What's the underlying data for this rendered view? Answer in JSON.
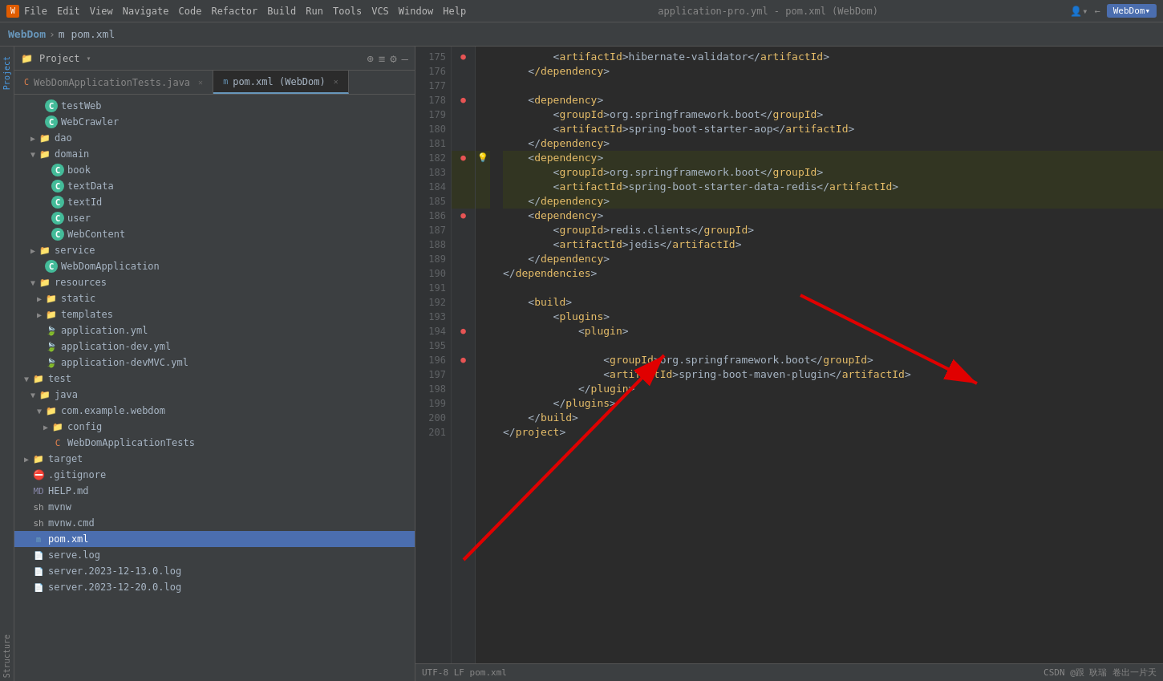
{
  "titlebar": {
    "app_icon": "W",
    "menu_items": [
      "File",
      "Edit",
      "View",
      "Navigate",
      "Code",
      "Refactor",
      "Build",
      "Run",
      "Tools",
      "VCS",
      "Window",
      "Help"
    ],
    "title": "application-pro.yml - pom.xml (WebDom)",
    "webdom_button": "WebDom▾"
  },
  "breadcrumb": {
    "project": "WebDom",
    "separator": "›",
    "file": "m pom.xml"
  },
  "tabs": [
    {
      "id": "java-tab",
      "label": "WebDomApplicationTests.java",
      "type": "java",
      "active": false
    },
    {
      "id": "xml-tab",
      "label": "pom.xml (WebDom)",
      "type": "xml",
      "active": true
    }
  ],
  "project_panel": {
    "title": "Project",
    "tree_items": [
      {
        "indent": 24,
        "arrow": "",
        "icon_type": "c",
        "label": "testWeb",
        "selected": false
      },
      {
        "indent": 24,
        "arrow": "",
        "icon_type": "c",
        "label": "WebCrawler",
        "selected": false
      },
      {
        "indent": 16,
        "arrow": "▶",
        "icon_type": "folder",
        "label": "dao",
        "selected": false
      },
      {
        "indent": 16,
        "arrow": "▼",
        "icon_type": "folder",
        "label": "domain",
        "selected": false
      },
      {
        "indent": 32,
        "arrow": "",
        "icon_type": "c",
        "label": "book",
        "selected": false
      },
      {
        "indent": 32,
        "arrow": "",
        "icon_type": "c",
        "label": "textData",
        "selected": false
      },
      {
        "indent": 32,
        "arrow": "",
        "icon_type": "c",
        "label": "textId",
        "selected": false
      },
      {
        "indent": 32,
        "arrow": "",
        "icon_type": "c",
        "label": "user",
        "selected": false
      },
      {
        "indent": 32,
        "arrow": "",
        "icon_type": "c",
        "label": "WebContent",
        "selected": false
      },
      {
        "indent": 16,
        "arrow": "▶",
        "icon_type": "folder",
        "label": "service",
        "selected": false
      },
      {
        "indent": 24,
        "arrow": "",
        "icon_type": "c",
        "label": "WebDomApplication",
        "selected": false
      },
      {
        "indent": 16,
        "arrow": "▼",
        "icon_type": "folder-res",
        "label": "resources",
        "selected": false
      },
      {
        "indent": 24,
        "arrow": "▶",
        "icon_type": "folder",
        "label": "static",
        "selected": false
      },
      {
        "indent": 24,
        "arrow": "▶",
        "icon_type": "folder",
        "label": "templates",
        "selected": false
      },
      {
        "indent": 24,
        "arrow": "",
        "icon_type": "yml",
        "label": "application.yml",
        "selected": false
      },
      {
        "indent": 24,
        "arrow": "",
        "icon_type": "yml",
        "label": "application-dev.yml",
        "selected": false
      },
      {
        "indent": 24,
        "arrow": "",
        "icon_type": "yml",
        "label": "application-devMVC.yml",
        "selected": false
      },
      {
        "indent": 8,
        "arrow": "▼",
        "icon_type": "folder",
        "label": "test",
        "selected": false
      },
      {
        "indent": 16,
        "arrow": "▼",
        "icon_type": "folder",
        "label": "java",
        "selected": false
      },
      {
        "indent": 24,
        "arrow": "▼",
        "icon_type": "folder",
        "label": "com.example.webdom",
        "selected": false
      },
      {
        "indent": 32,
        "arrow": "▶",
        "icon_type": "folder",
        "label": "config",
        "selected": false
      },
      {
        "indent": 32,
        "arrow": "",
        "icon_type": "java",
        "label": "WebDomApplicationTests",
        "selected": false
      },
      {
        "indent": 8,
        "arrow": "▶",
        "icon_type": "folder-target",
        "label": "target",
        "selected": false
      },
      {
        "indent": 8,
        "arrow": "",
        "icon_type": "git",
        "label": ".gitignore",
        "selected": false
      },
      {
        "indent": 8,
        "arrow": "",
        "icon_type": "md",
        "label": "HELP.md",
        "selected": false
      },
      {
        "indent": 8,
        "arrow": "",
        "icon_type": "sh",
        "label": "mvnw",
        "selected": false
      },
      {
        "indent": 8,
        "arrow": "",
        "icon_type": "sh",
        "label": "mvnw.cmd",
        "selected": false
      },
      {
        "indent": 8,
        "arrow": "",
        "icon_type": "xml",
        "label": "pom.xml",
        "selected": true
      },
      {
        "indent": 8,
        "arrow": "",
        "icon_type": "log",
        "label": "serve.log",
        "selected": false
      },
      {
        "indent": 8,
        "arrow": "",
        "icon_type": "log",
        "label": "server.2023-12-13.0.log",
        "selected": false
      },
      {
        "indent": 8,
        "arrow": "",
        "icon_type": "log",
        "label": "server.2023-12-20.0.log",
        "selected": false
      }
    ]
  },
  "code": {
    "lines": [
      {
        "num": 175,
        "indent": 8,
        "content": "<artifactId>hibernate-validator</artifactId>",
        "marker": "",
        "highlighted": false
      },
      {
        "num": 176,
        "indent": 4,
        "content": "</dependency>",
        "marker": "",
        "highlighted": false
      },
      {
        "num": 177,
        "indent": 0,
        "content": "",
        "marker": "",
        "highlighted": false
      },
      {
        "num": 178,
        "indent": 4,
        "content": "<dependency>",
        "marker": "●",
        "highlighted": false
      },
      {
        "num": 179,
        "indent": 8,
        "content": "<groupId>org.springframework.boot</groupId>",
        "marker": "",
        "highlighted": false
      },
      {
        "num": 180,
        "indent": 8,
        "content": "<artifactId>spring-boot-starter-aop</artifactId>",
        "marker": "",
        "highlighted": false
      },
      {
        "num": 181,
        "indent": 4,
        "content": "</dependency>",
        "marker": "",
        "highlighted": false
      },
      {
        "num": 182,
        "indent": 4,
        "content": "<dependency>",
        "marker": "●",
        "highlighted": true,
        "bulb": true
      },
      {
        "num": 183,
        "indent": 8,
        "content": "<groupId>org.springframework.boot</groupId>",
        "marker": "",
        "highlighted": true
      },
      {
        "num": 184,
        "indent": 8,
        "content": "<artifactId>spring-boot-starter-data-redis</artifactId>",
        "marker": "",
        "highlighted": true
      },
      {
        "num": 185,
        "indent": 4,
        "content": "</dependency>",
        "marker": "",
        "highlighted": true
      },
      {
        "num": 186,
        "indent": 4,
        "content": "<dependency>",
        "marker": "●",
        "highlighted": false
      },
      {
        "num": 187,
        "indent": 8,
        "content": "<groupId>redis.clients</groupId>",
        "marker": "",
        "highlighted": false
      },
      {
        "num": 188,
        "indent": 8,
        "content": "<artifactId>jedis</artifactId>",
        "marker": "",
        "highlighted": false
      },
      {
        "num": 189,
        "indent": 4,
        "content": "</dependency>",
        "marker": "",
        "highlighted": false
      },
      {
        "num": 190,
        "indent": 0,
        "content": "</dependencies>",
        "marker": "",
        "highlighted": false
      },
      {
        "num": 191,
        "indent": 0,
        "content": "",
        "marker": "",
        "highlighted": false
      },
      {
        "num": 192,
        "indent": 4,
        "content": "<build>",
        "marker": "",
        "highlighted": false
      },
      {
        "num": 193,
        "indent": 8,
        "content": "<plugins>",
        "marker": "",
        "highlighted": false
      },
      {
        "num": 194,
        "indent": 12,
        "content": "<plugin>",
        "marker": "●",
        "highlighted": false
      },
      {
        "num": 195,
        "indent": 0,
        "content": "",
        "marker": "",
        "highlighted": false
      },
      {
        "num": 196,
        "indent": 16,
        "content": "<groupId>org.springframework.boot</groupId>",
        "marker": "●",
        "highlighted": false
      },
      {
        "num": 197,
        "indent": 16,
        "content": "<artifactId>spring-boot-maven-plugin</artifactId>",
        "marker": "",
        "highlighted": false
      },
      {
        "num": 198,
        "indent": 12,
        "content": "</plugin>",
        "marker": "",
        "highlighted": false
      },
      {
        "num": 199,
        "indent": 8,
        "content": "</plugins>",
        "marker": "",
        "highlighted": false
      },
      {
        "num": 200,
        "indent": 4,
        "content": "</build>",
        "marker": "",
        "highlighted": false
      },
      {
        "num": 201,
        "indent": 0,
        "content": "</project>",
        "marker": "",
        "highlighted": false
      }
    ]
  },
  "status_bar": {
    "right_text": "CSDN @跟 耿瑞 卷出一片天"
  }
}
